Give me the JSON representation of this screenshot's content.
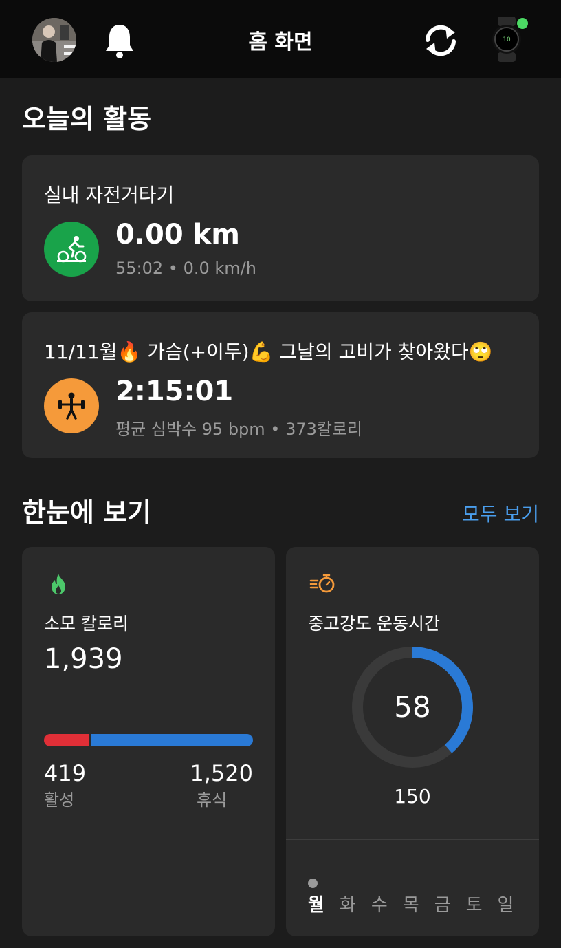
{
  "header": {
    "title": "홈 화면"
  },
  "today": {
    "section_title": "오늘의 활동",
    "activities": [
      {
        "name": "실내 자전거타기",
        "main": "0.00 km",
        "sub": "55:02 • 0.0 km/h",
        "icon": "cycling-icon",
        "color": "#19a34a"
      },
      {
        "name": "11/11월🔥 가슴(+이두)💪 그날의 고비가 찾아왔다🙄",
        "main": "2:15:01",
        "sub": "평균 심박수 95 bpm • 373칼로리",
        "icon": "strength-training-icon",
        "color": "#f59a3a"
      }
    ]
  },
  "glance": {
    "section_title": "한눈에 보기",
    "see_all": "모두 보기",
    "calories": {
      "label": "소모 칼로리",
      "total": "1,939",
      "active_value": "419",
      "active_label": "활성",
      "rest_value": "1,520",
      "rest_label": "휴식",
      "active_fraction": 0.216,
      "active_color": "#e02f37",
      "rest_color": "#2a7ad6",
      "icon": "flame-icon"
    },
    "intensity": {
      "label": "중고강도 운동시간",
      "value": "58",
      "goal": "150",
      "progress_fraction": 0.387,
      "ring_color": "#2a7ad6",
      "icon": "stopwatch-icon",
      "days": [
        "월",
        "화",
        "수",
        "목",
        "금",
        "토",
        "일"
      ]
    }
  }
}
